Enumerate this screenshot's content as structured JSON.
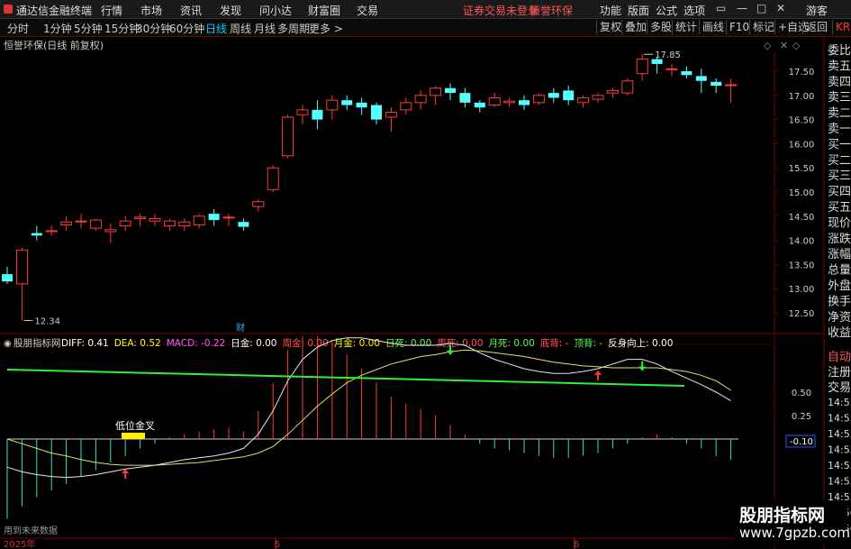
{
  "app": {
    "title": "通达信金融终端",
    "menus": [
      "行情",
      "市场",
      "资讯",
      "发现",
      "问小达",
      "财富圈",
      "交易"
    ],
    "status_message": "证券交易未登录",
    "stock_brand": "恒誉环保",
    "right_menus": [
      "功能",
      "版面",
      "公式",
      "选项"
    ],
    "guest": "游客",
    "window_controls": [
      "▭",
      "—",
      "□",
      "✕"
    ]
  },
  "toolbar": {
    "periods": [
      "分时",
      "1分钟",
      "5分钟",
      "15分钟",
      "30分钟",
      "60分钟",
      "日线",
      "周线",
      "月线",
      "多周期",
      "更多 >"
    ],
    "active_period": "日线",
    "right_buttons": [
      "复权",
      "叠加",
      "多股",
      "统计",
      "画线",
      "F10",
      "标记",
      "+自选",
      "返回"
    ],
    "corner": "KR"
  },
  "main_chart": {
    "title": "恒誉环保(日线 前复权)",
    "price_axis": [
      "17.50",
      "17.00",
      "16.50",
      "16.00",
      "15.50",
      "15.00",
      "14.50",
      "14.00",
      "13.50",
      "13.00",
      "12.50"
    ],
    "high_label": "17.85",
    "low_label": "12.34",
    "event_marker": "财",
    "ohlc": [
      [
        13.3,
        13.15,
        13.45,
        13.1
      ],
      [
        13.1,
        13.8,
        13.85,
        12.34
      ],
      [
        14.15,
        14.1,
        14.3,
        14.0
      ],
      [
        14.18,
        14.2,
        14.3,
        14.1
      ],
      [
        14.32,
        14.38,
        14.5,
        14.2
      ],
      [
        14.4,
        14.4,
        14.55,
        14.25
      ],
      [
        14.25,
        14.42,
        14.45,
        14.2
      ],
      [
        14.18,
        14.22,
        14.35,
        13.95
      ],
      [
        14.3,
        14.4,
        14.5,
        14.2
      ],
      [
        14.45,
        14.48,
        14.55,
        14.3
      ],
      [
        14.4,
        14.45,
        14.55,
        14.3
      ],
      [
        14.3,
        14.4,
        14.45,
        14.2
      ],
      [
        14.3,
        14.38,
        14.45,
        14.2
      ],
      [
        14.32,
        14.5,
        14.55,
        14.25
      ],
      [
        14.55,
        14.42,
        14.65,
        14.3
      ],
      [
        14.48,
        14.48,
        14.55,
        14.3
      ],
      [
        14.38,
        14.28,
        14.45,
        14.2
      ],
      [
        14.7,
        14.8,
        14.85,
        14.6
      ],
      [
        15.05,
        15.5,
        15.55,
        15.0
      ],
      [
        15.75,
        16.55,
        16.6,
        15.7
      ],
      [
        16.6,
        16.7,
        16.8,
        16.4
      ],
      [
        16.7,
        16.5,
        16.9,
        16.3
      ],
      [
        16.7,
        16.9,
        17.0,
        16.5
      ],
      [
        16.9,
        16.8,
        17.0,
        16.7
      ],
      [
        16.85,
        16.75,
        16.95,
        16.6
      ],
      [
        16.8,
        16.5,
        16.85,
        16.4
      ],
      [
        16.55,
        16.65,
        16.75,
        16.25
      ],
      [
        16.7,
        16.85,
        16.95,
        16.6
      ],
      [
        16.85,
        17.0,
        17.1,
        16.7
      ],
      [
        17.0,
        17.15,
        17.2,
        16.8
      ],
      [
        17.15,
        17.05,
        17.25,
        16.9
      ],
      [
        17.05,
        16.85,
        17.15,
        16.75
      ],
      [
        16.85,
        16.75,
        16.9,
        16.65
      ],
      [
        16.8,
        16.95,
        17.05,
        16.75
      ],
      [
        16.85,
        16.88,
        16.95,
        16.75
      ],
      [
        16.9,
        16.8,
        17.0,
        16.7
      ],
      [
        16.85,
        17.0,
        17.05,
        16.8
      ],
      [
        17.05,
        16.95,
        17.15,
        16.85
      ],
      [
        17.1,
        16.9,
        17.2,
        16.8
      ],
      [
        16.85,
        16.95,
        17.0,
        16.75
      ],
      [
        16.92,
        17.0,
        17.05,
        16.85
      ],
      [
        17.05,
        17.1,
        17.15,
        16.95
      ],
      [
        17.05,
        17.3,
        17.35,
        17.0
      ],
      [
        17.45,
        17.75,
        17.85,
        17.3
      ],
      [
        17.75,
        17.65,
        17.8,
        17.45
      ],
      [
        17.55,
        17.55,
        17.65,
        17.4
      ],
      [
        17.5,
        17.42,
        17.6,
        17.35
      ],
      [
        17.4,
        17.3,
        17.55,
        17.05
      ],
      [
        17.28,
        17.2,
        17.35,
        17.05
      ],
      [
        17.22,
        17.22,
        17.35,
        16.85
      ]
    ]
  },
  "indicator": {
    "name": "股朋指标网",
    "readouts": [
      {
        "label": "DIFF: 0.41",
        "color": "#ffffff"
      },
      {
        "label": "DEA: 0.52",
        "color": "#ffff00"
      },
      {
        "label": "MACD: -0.22",
        "color": "#ff55ff"
      },
      {
        "label": "日金: 0.00",
        "color": "#ffffff"
      },
      {
        "label": "周金: 0.00",
        "color": "#ff5555"
      },
      {
        "label": "月金: 0.00",
        "color": "#ffff00"
      },
      {
        "label": "日死: 0.00",
        "color": "#55ff55"
      },
      {
        "label": "周死: 0.00",
        "color": "#ff5555"
      },
      {
        "label": "月死: 0.00",
        "color": "#55ff55"
      },
      {
        "label": "底背: -",
        "color": "#ff5555"
      },
      {
        "label": "顶背: -",
        "color": "#55ff55"
      },
      {
        "label": "反身向上: 0.00",
        "color": "#ffffff"
      }
    ],
    "annotation": "低位金叉",
    "axis_labels": [
      "0.50",
      "0.25",
      "-0.10"
    ],
    "time_labels": [
      "14:55",
      "14:55",
      "14:55",
      "14:55",
      "14:55",
      "14:55",
      "14:55",
      "14:56",
      "14:56"
    ],
    "macd": [
      -0.85,
      -0.72,
      -0.62,
      -0.55,
      -0.48,
      -0.4,
      -0.33,
      -0.25,
      -0.18,
      -0.1,
      -0.05,
      0.02,
      0.05,
      0.08,
      0.1,
      0.12,
      0.08,
      0.3,
      0.6,
      0.95,
      1.1,
      1.1,
      1.05,
      0.9,
      0.75,
      0.6,
      0.45,
      0.38,
      0.32,
      0.25,
      0.15,
      0.05,
      -0.05,
      -0.1,
      -0.12,
      -0.15,
      -0.18,
      -0.2,
      -0.2,
      -0.18,
      -0.15,
      -0.1,
      -0.05,
      0.02,
      0.05,
      0.02,
      -0.05,
      -0.1,
      -0.18,
      -0.22
    ],
    "diff": [
      -0.3,
      -0.35,
      -0.38,
      -0.4,
      -0.41,
      -0.4,
      -0.38,
      -0.35,
      -0.32,
      -0.3,
      -0.28,
      -0.25,
      -0.22,
      -0.2,
      -0.18,
      -0.15,
      -0.1,
      0.05,
      0.3,
      0.62,
      0.85,
      0.98,
      1.05,
      1.08,
      1.08,
      1.05,
      1.02,
      1.0,
      1.0,
      1.0,
      1.02,
      1.0,
      0.92,
      0.85,
      0.8,
      0.75,
      0.72,
      0.7,
      0.7,
      0.72,
      0.75,
      0.8,
      0.85,
      0.85,
      0.8,
      0.72,
      0.65,
      0.58,
      0.5,
      0.41
    ],
    "dea": [
      0.0,
      -0.05,
      -0.1,
      -0.15,
      -0.18,
      -0.22,
      -0.25,
      -0.27,
      -0.28,
      -0.28,
      -0.28,
      -0.27,
      -0.26,
      -0.25,
      -0.23,
      -0.21,
      -0.19,
      -0.15,
      -0.08,
      0.05,
      0.2,
      0.35,
      0.48,
      0.6,
      0.68,
      0.74,
      0.8,
      0.84,
      0.88,
      0.9,
      0.93,
      0.95,
      0.94,
      0.92,
      0.9,
      0.88,
      0.85,
      0.82,
      0.8,
      0.78,
      0.77,
      0.76,
      0.76,
      0.76,
      0.76,
      0.74,
      0.72,
      0.68,
      0.62,
      0.52
    ],
    "up_arrows": [
      8,
      40
    ],
    "down_arrows": [
      30,
      43
    ]
  },
  "date_axis": {
    "year": "2025年",
    "month5": "5",
    "month6": "6"
  },
  "side_panel": {
    "top_items": [
      "委比",
      "卖五",
      "卖四",
      "卖三",
      "卖二",
      "卖一",
      "买一",
      "买二",
      "买三",
      "买四",
      "买五",
      "现价",
      "涨跌",
      "涨幅",
      "总量",
      "外盘",
      "换手",
      "净资",
      "收益"
    ],
    "bottom_items": [
      "自动",
      "注册",
      "交易"
    ]
  },
  "bottom_text": "用到未来数据",
  "watermark": {
    "line1": "股朋指标网",
    "line2": "www.7gpzb.com"
  }
}
